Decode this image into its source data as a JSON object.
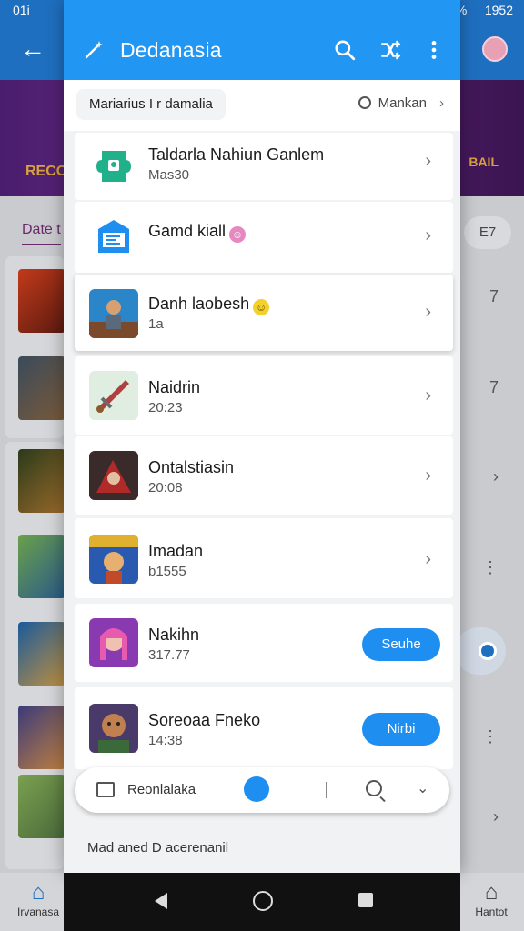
{
  "status_bar": {
    "left": "01i",
    "battery": "80%",
    "time": "1952"
  },
  "background_app": {
    "banner_left": "RECO",
    "banner_right": "BAIL",
    "tab_label": "Date t",
    "chip_label": "E7",
    "row_marks": [
      "7",
      "7",
      "›",
      "⋮",
      "⋮",
      "›"
    ],
    "nav_left_label": "Irvanasa",
    "nav_right_label": "Hantot"
  },
  "panel": {
    "title": "Dedanasia",
    "filter": {
      "chip_label": "Mariarius I r damalia",
      "search_label": "Mankan"
    },
    "items": [
      {
        "title": "Taldarla Nahiun Ganlem",
        "subtitle": "Mas30",
        "icon": "green-puzzle-icon",
        "action": "chevron"
      },
      {
        "title": "Gamd kiall",
        "subtitle": "",
        "icon": "blue-ticket-icon",
        "badge": "pink-smile",
        "action": "chevron"
      },
      {
        "title": "Danh laobesh",
        "subtitle": "1a",
        "icon": "game-warrior-icon",
        "badge": "yellow-smile",
        "action": "chevron"
      },
      {
        "title": "Naidrin",
        "subtitle": "20:23",
        "icon": "game-sword-icon",
        "action": "chevron"
      },
      {
        "title": "Ontalstiasin",
        "subtitle": "20:08",
        "icon": "game-battle-icon",
        "action": "chevron"
      },
      {
        "title": "Imadan",
        "subtitle": "b1555",
        "icon": "game-hero-icon",
        "action": "chevron"
      },
      {
        "title": "Nakihn",
        "subtitle": "317.77",
        "icon": "game-princess-icon",
        "action": "button",
        "button_label": "Seuhe"
      },
      {
        "title": "Soreoaa Fneko",
        "subtitle": "14:38",
        "icon": "game-ogre-icon",
        "action": "button",
        "button_label": "Nirbi"
      }
    ],
    "bottom_bar": {
      "label": "Reonlalaka"
    },
    "footer_text": "Mad aned D acerenanil"
  },
  "colors": {
    "primary": "#2196f3",
    "button": "#1e8ef0",
    "bg_appbar": "#1f6fc0"
  }
}
